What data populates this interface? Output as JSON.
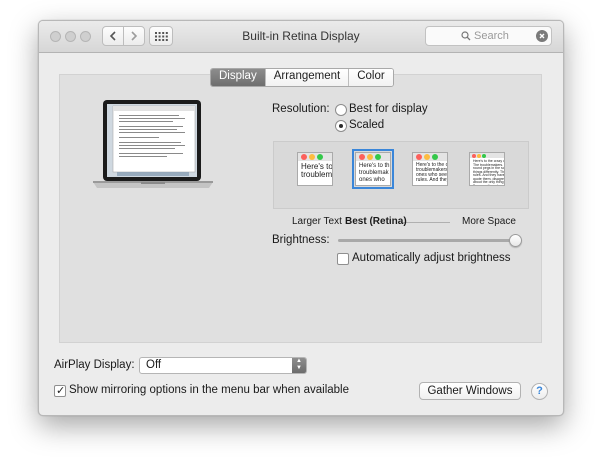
{
  "window": {
    "title": "Built-in Retina Display",
    "search_placeholder": "Search"
  },
  "tabs": [
    {
      "label": "Display",
      "active": true
    },
    {
      "label": "Arrangement",
      "active": false
    },
    {
      "label": "Color",
      "active": false
    }
  ],
  "resolution": {
    "label": "Resolution:",
    "option_best": "Best for display",
    "option_scaled": "Scaled",
    "selected": "Scaled"
  },
  "scaled_options": [
    {
      "label": "Larger Text",
      "preview": "Here's to\ntroublem",
      "selected": false
    },
    {
      "label": "Best (Retina)",
      "preview": "Here's to th\ntroublemak\nones who",
      "selected": true
    },
    {
      "label": "",
      "preview": "Here's to the c\ntroublemakers\nones who see t\nrules. And they",
      "selected": false
    },
    {
      "label": "More Space",
      "preview": "Here's to the crazy ones\nThe troublemakers. The\nround pegs in the square\nthings differently. They\nrules. And they have no\nquote them, disagree\nabout the only thing you\nBecause they change",
      "selected": false
    }
  ],
  "brightness": {
    "label": "Brightness:",
    "value": 1.0,
    "auto_label": "Automatically adjust brightness",
    "auto_checked": false
  },
  "airplay": {
    "label": "AirPlay Display:",
    "value": "Off"
  },
  "mirroring": {
    "label": "Show mirroring options in the menu bar when available",
    "checked": true
  },
  "buttons": {
    "gather": "Gather Windows",
    "help": "?"
  },
  "colors": {
    "accent": "#3a86d9",
    "close": "#fc605c",
    "minimize": "#fdbc40",
    "zoom": "#34c84a"
  }
}
